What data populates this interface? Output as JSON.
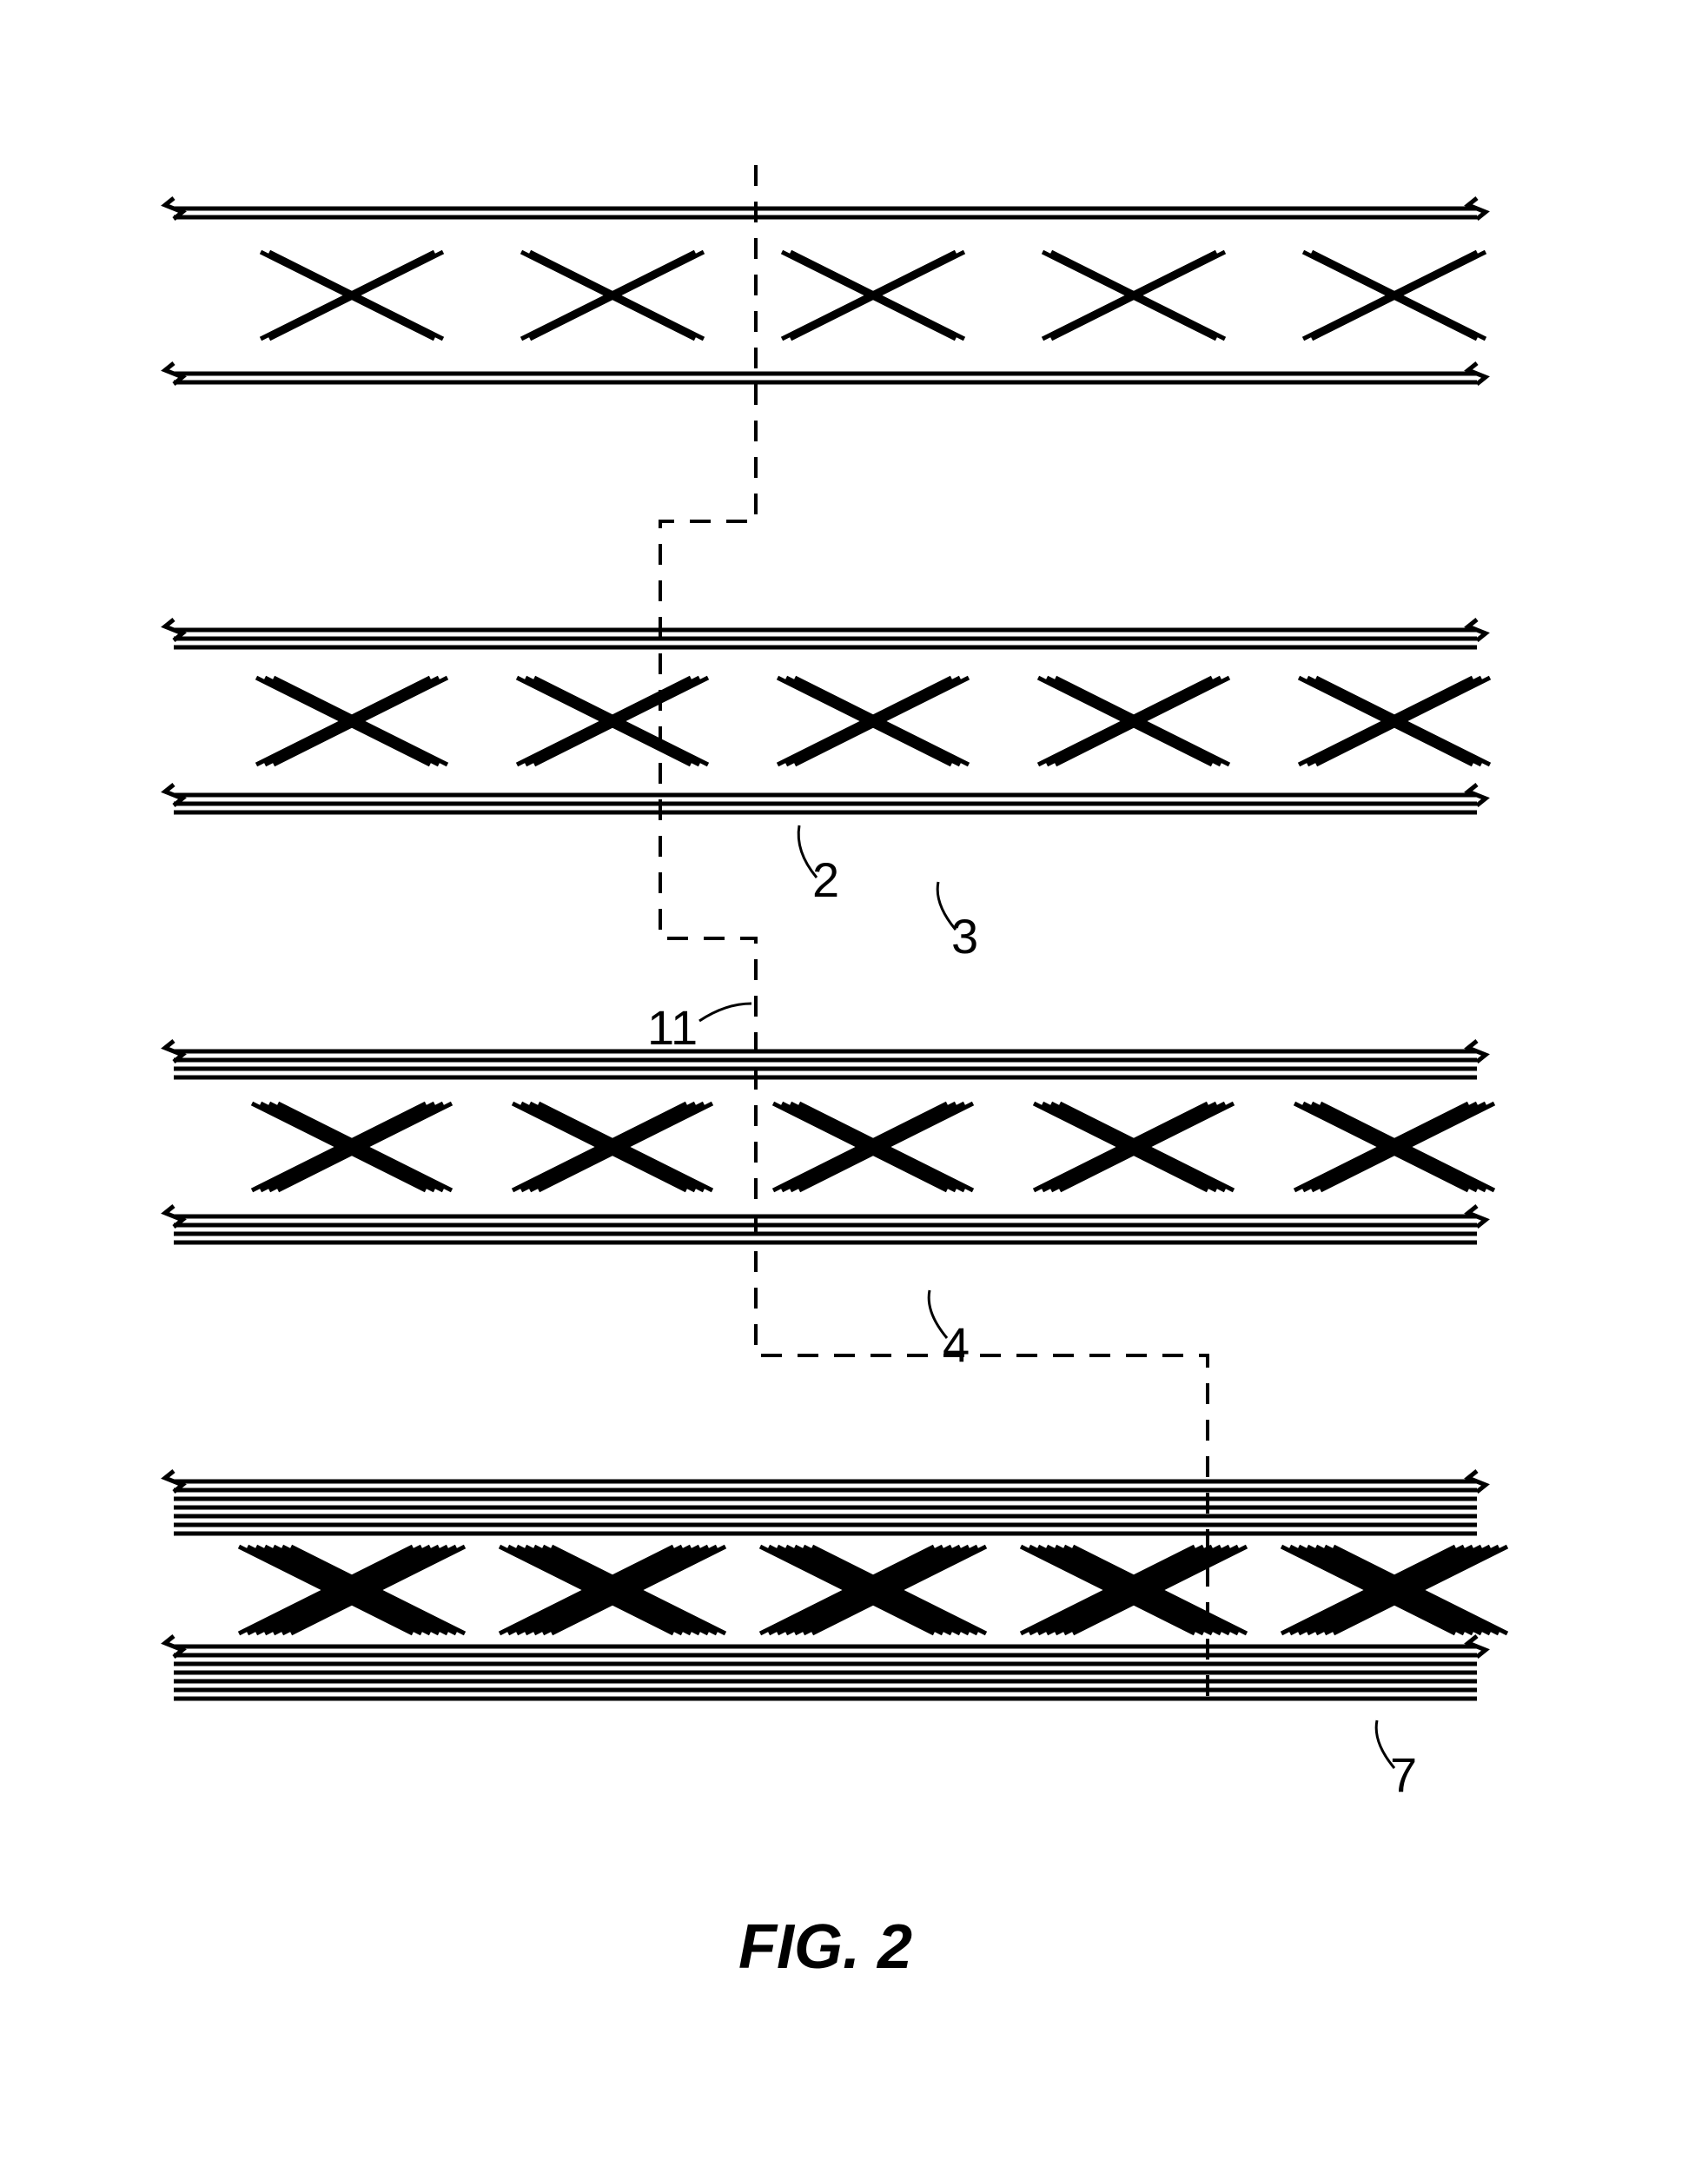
{
  "figure_label": "FIG. 2",
  "refs": {
    "r2": "2",
    "r3": "3",
    "r4": "4",
    "r7": "7",
    "r11": "11"
  },
  "chart_data": {
    "type": "diagram",
    "title": "FIG. 2",
    "description": "Patent figure showing four horizontal multi-filament braided / lattice structures (stents or scaffolds) of increasing filament count, depicted side by side, cut at both ends. A stepped dashed phantom line labeled 11 passes through the structures. Reference numerals 2, 3, 4, 7 label individual structures and 11 labels the phantom line.",
    "structures": [
      {
        "ref": "2",
        "position": "top",
        "filaments": 2
      },
      {
        "ref": "3",
        "position": "upper-middle",
        "filaments": 3
      },
      {
        "ref": "4",
        "position": "lower-middle",
        "filaments": 4
      },
      {
        "ref": "7",
        "position": "bottom",
        "filaments": 7
      }
    ],
    "phantom_line_ref": "11",
    "annotations": [
      "2",
      "3",
      "4",
      "7",
      "11"
    ]
  }
}
